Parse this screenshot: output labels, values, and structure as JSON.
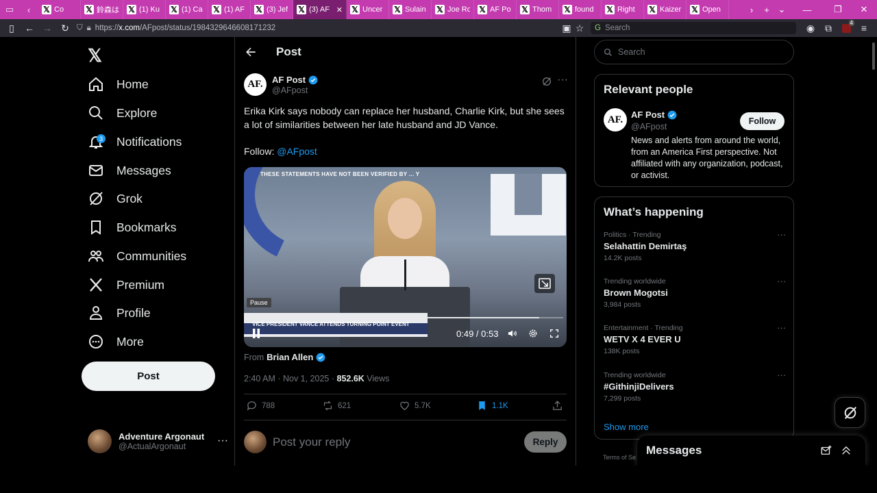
{
  "browser": {
    "tabs": [
      {
        "label": "Co",
        "active": false
      },
      {
        "label": "鈴森は",
        "active": false
      },
      {
        "label": "(1) Ku",
        "active": false
      },
      {
        "label": "(1) Ca",
        "active": false
      },
      {
        "label": "(1) AF",
        "active": false
      },
      {
        "label": "(3) Jef",
        "active": false
      },
      {
        "label": "(3) AF",
        "active": true
      },
      {
        "label": "Uncer",
        "active": false
      },
      {
        "label": "Sulain",
        "active": false
      },
      {
        "label": "Joe Ro",
        "active": false
      },
      {
        "label": "AF Po",
        "active": false
      },
      {
        "label": "Thom",
        "active": false
      },
      {
        "label": "found",
        "active": false
      },
      {
        "label": "Right",
        "active": false
      },
      {
        "label": "Kaizer",
        "active": false
      },
      {
        "label": "Open",
        "active": false
      }
    ],
    "url_prefix": "https://",
    "url_domain": "x.com",
    "url_path": "/AFpost/status/1984329646608171232",
    "search_placeholder": "Search",
    "extension_badge": "4"
  },
  "nav": {
    "items": [
      {
        "label": "Home",
        "icon": "home-icon"
      },
      {
        "label": "Explore",
        "icon": "search-icon"
      },
      {
        "label": "Notifications",
        "icon": "bell-icon",
        "badge": "3"
      },
      {
        "label": "Messages",
        "icon": "mail-icon"
      },
      {
        "label": "Grok",
        "icon": "grok-icon"
      },
      {
        "label": "Bookmarks",
        "icon": "bookmark-icon"
      },
      {
        "label": "Communities",
        "icon": "communities-icon"
      },
      {
        "label": "Premium",
        "icon": "x-premium-icon"
      },
      {
        "label": "Profile",
        "icon": "profile-icon"
      },
      {
        "label": "More",
        "icon": "more-circle-icon"
      }
    ],
    "post_button": "Post",
    "account": {
      "name": "Adventure Argonaut",
      "handle": "@ActualArgonaut"
    }
  },
  "post": {
    "header_title": "Post",
    "author": {
      "name": "AF Post",
      "handle": "@AFpost",
      "avatar_text": "AF."
    },
    "text": "Erika Kirk says nobody can replace her husband, Charlie Kirk, but she sees a lot of similarities between her late husband and JD Vance.",
    "follow_prefix": "Follow:",
    "follow_mention": "@AFpost",
    "video": {
      "top_caption": "THESE STATEMENTS HAVE NOT BEEN VERIFIED BY ... Y",
      "lower_third": "VICE PRESIDENT VANCE ATTENDS TURNING POINT EVENT",
      "tooltip": "Pause",
      "time": "0:49 / 0:53",
      "progress": 0.925
    },
    "from_prefix": "From",
    "from_name": "Brian Allen",
    "timestamp": "2:40 AM · Nov 1, 2025 ·",
    "views_count": "852.6K",
    "views_label": "Views",
    "actions": {
      "replies": "788",
      "reposts": "621",
      "likes": "5.7K",
      "bookmarks": "1.1K"
    },
    "reply_placeholder": "Post your reply",
    "reply_button": "Reply"
  },
  "right": {
    "search_placeholder": "Search",
    "relevant_title": "Relevant people",
    "relevant_person": {
      "name": "AF Post",
      "handle": "@AFpost",
      "avatar_text": "AF.",
      "follow": "Follow",
      "bio": "News and alerts from around the world, from an America First perspective. Not affiliated with any organization, podcast, or activist."
    },
    "happening_title": "What’s happening",
    "trends": [
      {
        "category": "Politics · Trending",
        "name": "Selahattin Demirtaş",
        "posts": "14.2K posts"
      },
      {
        "category": "Trending worldwide",
        "name": "Brown Mogotsi",
        "posts": "3,984 posts"
      },
      {
        "category": "Entertainment · Trending",
        "name": "WETV X 4 EVER U",
        "posts": "138K posts"
      },
      {
        "category": "Trending worldwide",
        "name": "#GithinjiDelivers",
        "posts": "7,299 posts"
      }
    ],
    "show_more": "Show more",
    "terms": "Terms of Se",
    "messages_title": "Messages"
  },
  "colors": {
    "accent": "#1d9bf0",
    "tabbar": "#c43bb0",
    "background": "#000000"
  }
}
